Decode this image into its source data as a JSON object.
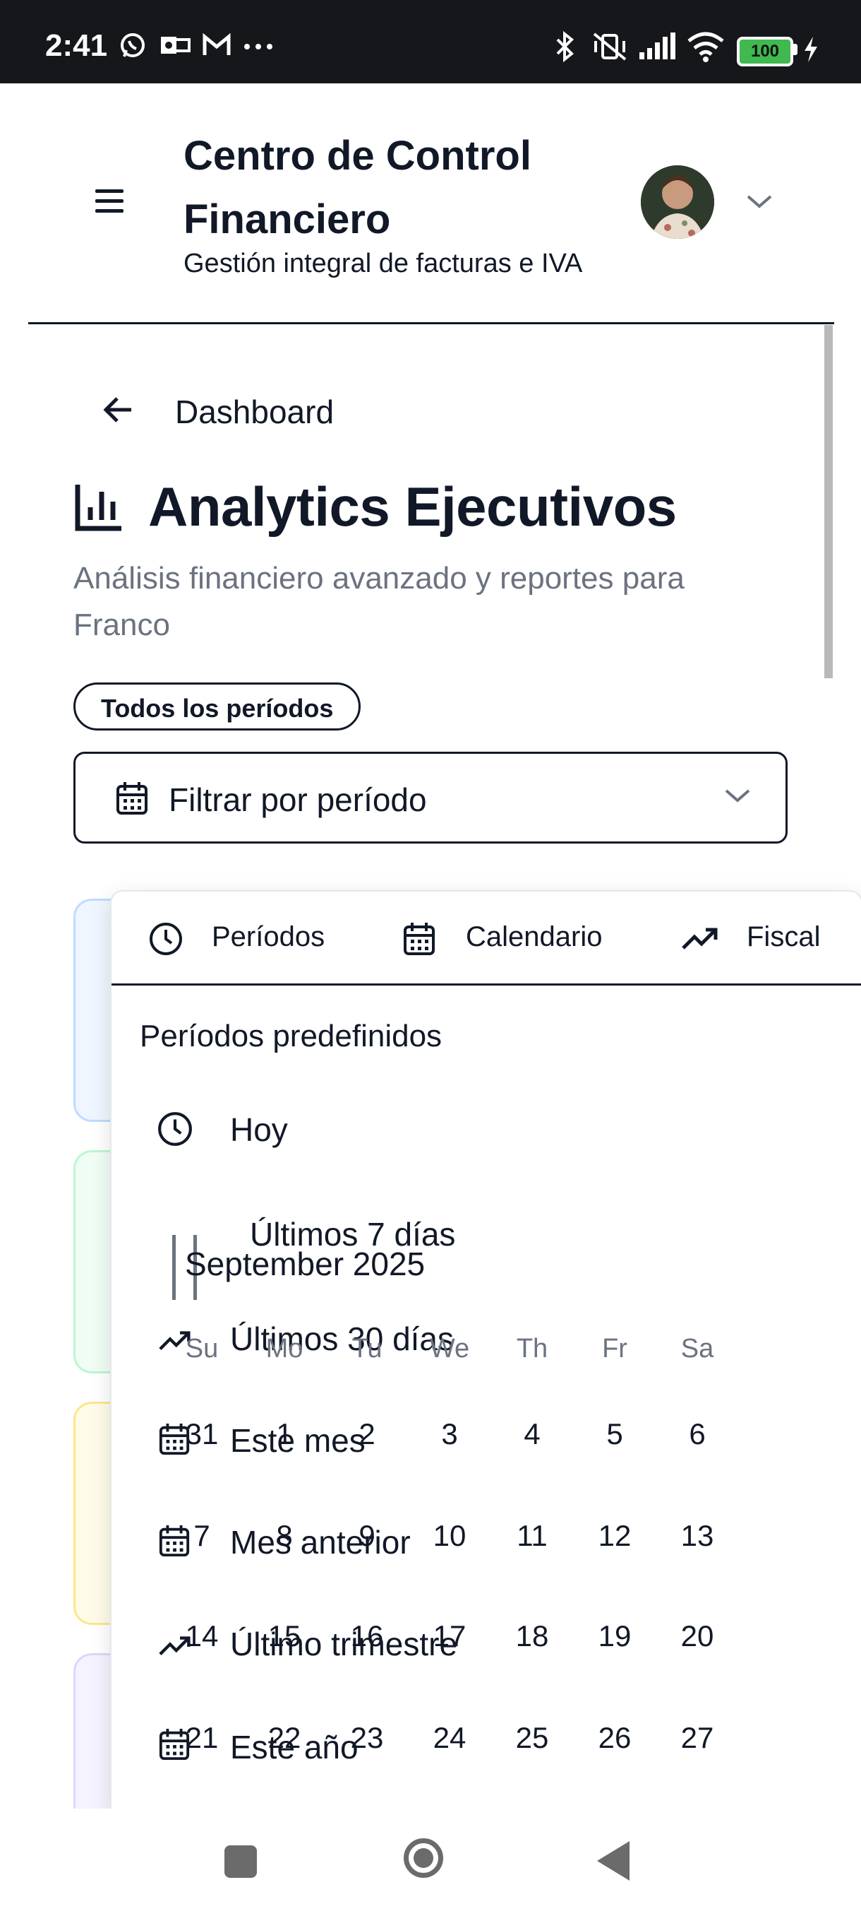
{
  "status_bar": {
    "time": "2:41",
    "battery": "100",
    "left_icons": [
      "whatsapp-icon",
      "outlook-icon",
      "gmail-icon",
      "more-dots-icon"
    ],
    "right_icons": [
      "bluetooth-icon",
      "vibrate-off-icon",
      "signal-icon",
      "wifi-icon",
      "battery-icon",
      "charging-icon"
    ]
  },
  "header": {
    "title_line1": "Centro de Control",
    "title_line2": "Financiero",
    "subtitle": "Gestión integral de facturas e IVA"
  },
  "page": {
    "back_label": "Dashboard",
    "title": "Analytics Ejecutivos",
    "description": "Análisis financiero avanzado y reportes para Franco",
    "period_badge": "Todos los períodos",
    "filter_placeholder": "Filtrar por período"
  },
  "dropdown": {
    "tabs": [
      {
        "label": "Períodos",
        "icon": "clock-icon"
      },
      {
        "label": "Calendario",
        "icon": "calendar-icon"
      },
      {
        "label": "Fiscal",
        "icon": "trending-up-icon"
      }
    ],
    "section_title": "Períodos predefinidos",
    "options": [
      {
        "label": "Hoy",
        "icon": "clock-icon"
      },
      {
        "label": "Últimos 7 días",
        "icon": ""
      },
      {
        "label": "Últimos 30 días",
        "icon": "trending-up-icon"
      },
      {
        "label": "Este mes",
        "icon": "calendar-icon"
      },
      {
        "label": "Mes anterior",
        "icon": "calendar-icon"
      },
      {
        "label": "Último trimestre",
        "icon": "trending-up-icon"
      },
      {
        "label": "Este año",
        "icon": "calendar-icon"
      }
    ],
    "calendar": {
      "month": "September 2025",
      "weekdays": [
        "Su",
        "Mo",
        "Tu",
        "We",
        "Th",
        "Fr",
        "Sa"
      ],
      "weeks": [
        [
          "31",
          "1",
          "2",
          "3",
          "4",
          "5",
          "6"
        ],
        [
          "7",
          "8",
          "9",
          "10",
          "11",
          "12",
          "13"
        ],
        [
          "14",
          "15",
          "16",
          "17",
          "18",
          "19",
          "20"
        ],
        [
          "21",
          "22",
          "23",
          "24",
          "25",
          "26",
          "27"
        ]
      ]
    }
  },
  "colors": {
    "text_primary": "#111827",
    "text_muted": "#6b7280",
    "card_blue": "#bfdbfe",
    "card_green": "#bbf7d0",
    "card_yellow": "#fde68a",
    "card_purple": "#ddd6fe"
  }
}
